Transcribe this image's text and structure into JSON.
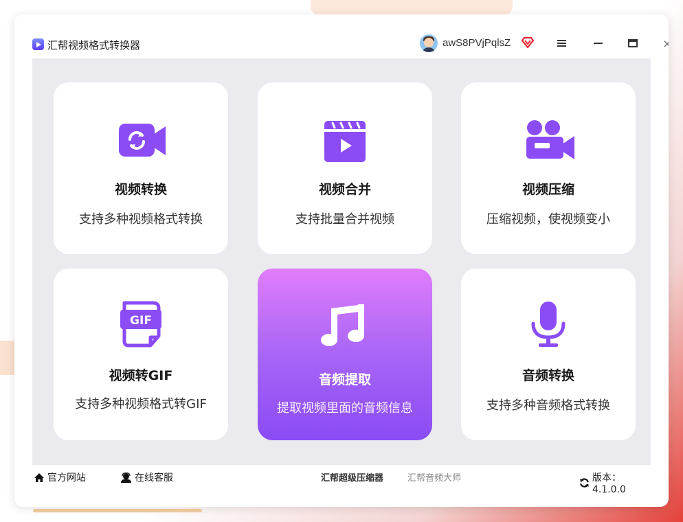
{
  "window": {
    "title": "汇帮视频格式转换器",
    "username": "awS8PVjPqlsZ",
    "controls": {
      "menu": "menu-icon",
      "minimize": "minimize-icon",
      "maximize": "maximize-icon",
      "close_glyph": "×"
    }
  },
  "cards": [
    {
      "title": "视频转换",
      "desc": "支持多种视频格式转换",
      "icon": "video-convert-icon"
    },
    {
      "title": "视频合并",
      "desc": "支持批量合并视频",
      "icon": "clapperboard-icon"
    },
    {
      "title": "视频压缩",
      "desc": "压缩视频，使视频变小",
      "icon": "video-camera-icon"
    },
    {
      "title": "视频转GIF",
      "desc": "支持多种视频格式转GIF",
      "icon": "gif-file-icon"
    },
    {
      "title": "音频提取",
      "desc": "提取视频里面的音频信息",
      "icon": "music-note-icon",
      "selected": true
    },
    {
      "title": "音频转换",
      "desc": "支持多种音频格式转换",
      "icon": "microphone-icon"
    }
  ],
  "footer": {
    "official_site": "官方网站",
    "online_service": "在线客服",
    "compressor_link": "汇帮超级压缩器",
    "audio_master_link": "汇帮音频大师",
    "version": "版本：4.1.0.0"
  },
  "colors": {
    "accent": "#8c4ef5",
    "accent_light": "#e07dfb",
    "icon_purple": "#8b4cf5",
    "vip_red": "#e8232f"
  }
}
